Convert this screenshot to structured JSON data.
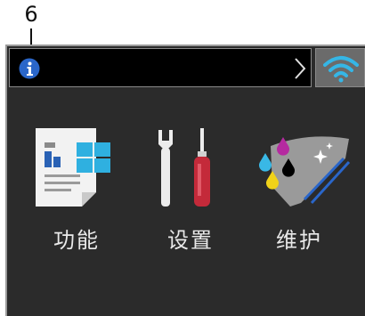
{
  "callout": {
    "number": "6"
  },
  "status_bar": {
    "info_icon": "info-icon",
    "chevron_icon": "chevron-right-icon"
  },
  "wifi": {
    "icon": "wifi-icon"
  },
  "tiles": [
    {
      "label": "功能",
      "icon": "functions-icon"
    },
    {
      "label": "设置",
      "icon": "settings-tools-icon"
    },
    {
      "label": "维护",
      "icon": "ink-maintenance-icon"
    }
  ],
  "colors": {
    "screen_bg": "#2b2b2b",
    "status_bg": "#000000",
    "info_blue": "#2a66c9",
    "wifi_cyan": "#35b6e6",
    "label_text": "#e9e9e9"
  }
}
